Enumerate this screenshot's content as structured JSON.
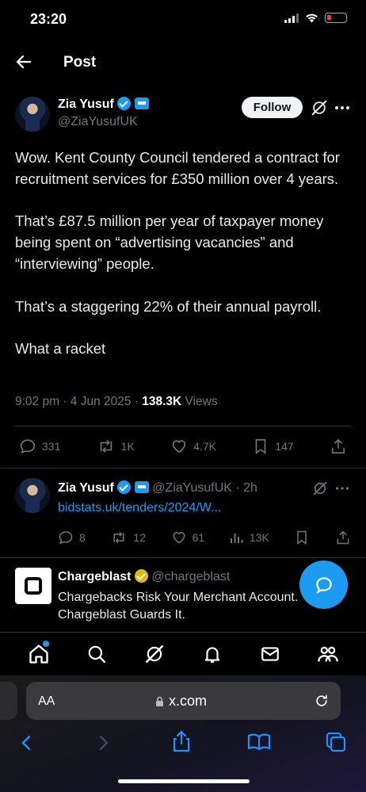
{
  "status": {
    "time": "23:20"
  },
  "header": {
    "title": "Post"
  },
  "post": {
    "author_name": "Zia Yusuf",
    "author_handle": "@ZiaYusufUK",
    "follow_label": "Follow",
    "text": "Wow. Kent County Council tendered a contract for recruitment services for £350 million over 4 years.\n\nThat’s £87.5 million per year of taxpayer money being spent on “advertising vacancies” and “interviewing” people.\n\nThat’s a staggering 22% of their annual payroll.\n\nWhat a racket",
    "time": "9:02 pm · 4 Jun 2025 · ",
    "views_count": "138.3K",
    "views_label": " Views",
    "replies": "331",
    "reposts": "1K",
    "likes": "4.7K",
    "bookmarks": "147"
  },
  "reply": {
    "author_name": "Zia Yusuf",
    "handle_time": "@ZiaYusufUK · 2h",
    "link": "bidstats.uk/tenders/2024/W...",
    "replies": "8",
    "reposts": "12",
    "likes": "61",
    "views": "13K"
  },
  "ad": {
    "name": "Chargeblast",
    "handle": "@chargeblast",
    "text": "Chargebacks Risk Your Merchant Account. Chargeblast Guards It."
  },
  "browser": {
    "aa_label": "AA",
    "url": "x.com"
  },
  "colors": {
    "accent": "#1d9bf0",
    "gold": "#e2b719",
    "muted": "#71767b"
  },
  "icons": [
    "back-arrow-icon",
    "verified-icon",
    "affiliate-badge-icon",
    "grok-icon",
    "more-icon",
    "reply-icon",
    "repost-icon",
    "like-icon",
    "bookmark-icon",
    "share-icon",
    "views-icon",
    "compose-message-icon",
    "home-icon",
    "search-icon",
    "notifications-icon",
    "messages-icon",
    "communities-icon",
    "reload-icon",
    "lock-icon"
  ]
}
